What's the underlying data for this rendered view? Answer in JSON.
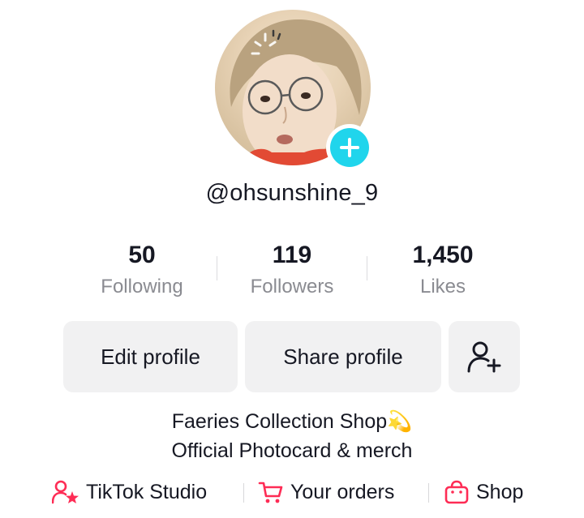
{
  "profile": {
    "username": "@ohsunshine_9"
  },
  "stats": {
    "following": {
      "value": "50",
      "label": "Following"
    },
    "followers": {
      "value": "119",
      "label": "Followers"
    },
    "likes": {
      "value": "1,450",
      "label": "Likes"
    }
  },
  "actions": {
    "edit_label": "Edit profile",
    "share_label": "Share profile",
    "add_friend_icon": "person-add-icon"
  },
  "bio": {
    "line1": "Faeries Collection Shop",
    "line1_emoji": "💫",
    "line2": "Official Photocard & merch"
  },
  "links": {
    "studio": {
      "label": "TikTok Studio",
      "icon": "creator-star-icon"
    },
    "orders": {
      "label": "Your orders",
      "icon": "cart-icon"
    },
    "shop": {
      "label": "Shop",
      "icon": "shopping-bag-icon"
    }
  },
  "colors": {
    "accent_cyan": "#20d5ec",
    "accent_pink": "#fe2c55",
    "button_bg": "#f1f1f2",
    "secondary_text": "#8a8b91"
  }
}
